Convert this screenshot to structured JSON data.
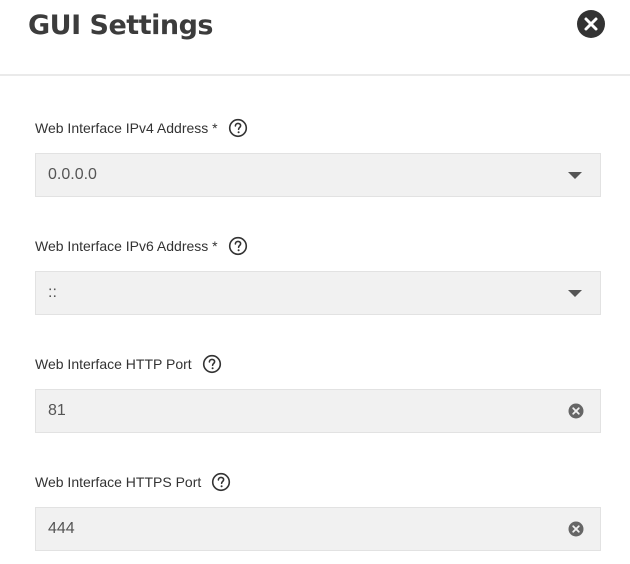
{
  "dialog": {
    "title": "GUI Settings",
    "close_icon": "close-circle-icon"
  },
  "fields": [
    {
      "label": "Web Interface IPv4 Address *",
      "value": "0.0.0.0",
      "control": "dropdown",
      "help_icon": "question-circle-icon"
    },
    {
      "label": "Web Interface IPv6 Address *",
      "value": "::",
      "control": "dropdown",
      "help_icon": "question-circle-icon"
    },
    {
      "label": "Web Interface HTTP Port",
      "value": "81",
      "control": "text-clearable",
      "help_icon": "question-circle-icon"
    },
    {
      "label": "Web Interface HTTPS Port",
      "value": "444",
      "control": "text-clearable",
      "help_icon": "question-circle-icon"
    }
  ],
  "colors": {
    "title": "#3c3c3c",
    "close_button": "#333333",
    "input_background": "#f1f1f1",
    "input_border": "#e2e2e2",
    "icon": "#555555"
  }
}
